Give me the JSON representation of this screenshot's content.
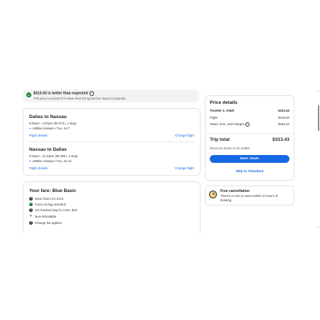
{
  "banner": {
    "title": "$313.43 is better than expected",
    "subtitle": "This price is at least 37% lower than the typical fare found on Expedia"
  },
  "flights": [
    {
      "route": "Dallas to Nassau",
      "time": "6:00am - 4:57pm (9h 57m, 1 stop)",
      "airline": "JetBlue Airways • Tue, Jul 7",
      "details_label": "Flight details",
      "change_label": "Change flight"
    },
    {
      "route": "Nassau to Dallas",
      "time": "6:24pm - 11:14pm (9h 50m, 1 stop)",
      "airline": "JetBlue Airways • Tue, Jul 14",
      "details_label": "Flight details",
      "change_label": "Change flight"
    }
  ],
  "fare": {
    "title": "Your fare: Blue Basic",
    "items": [
      {
        "icon": "dollar-icon",
        "text": "Seat choice for a fee"
      },
      {
        "icon": "check-icon",
        "text": "Carry-on bag included"
      },
      {
        "icon": "dollar-icon",
        "text": "1st checked bag for a fee: $18"
      },
      {
        "icon": "x-icon",
        "text": "Non-refundable"
      },
      {
        "icon": "dollar-icon",
        "text": "Change fee applies"
      }
    ]
  },
  "price": {
    "title": "Price details",
    "traveler_label": "Traveler 1: Adult",
    "traveler_value": "$313.43",
    "flight_label": "Flight",
    "flight_value": "$128.00",
    "taxes_label": "Taxes, fees, and charges",
    "taxes_value": "$185.43",
    "total_label": "Trip total",
    "total_value": "$313.43",
    "note": "Rates are shown in US dollars",
    "primary_button": "Next: Seats",
    "secondary_link": "Skip to Checkout"
  },
  "cancellation": {
    "title": "Free cancellation",
    "text": "There's no fee to cancel within 24 hours of booking."
  },
  "colors": {
    "accent": "#1668e3",
    "success": "#1a7f37",
    "dark": "#1f2a44"
  }
}
